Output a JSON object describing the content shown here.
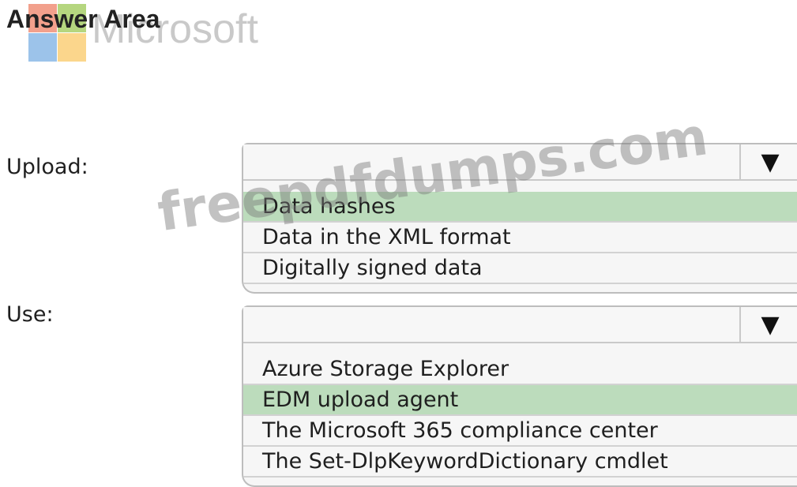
{
  "header": {
    "title": "Answer Area",
    "brand": "Microsoft"
  },
  "questions": [
    {
      "label": "Upload:",
      "options": [
        "Data hashes",
        "Data in the XML format",
        "Digitally signed data"
      ],
      "selected_index": 0
    },
    {
      "label": "Use:",
      "options": [
        "Azure Storage Explorer",
        "EDM upload agent",
        "The Microsoft 365 compliance center",
        "The Set-DlpKeywordDictionary cmdlet"
      ],
      "selected_index": 1
    }
  ],
  "dropdown_arrow": "▼",
  "watermark": "freepdfdumps.com",
  "colors": {
    "selected_option": "#bcdcbc",
    "logo_red": "#f2a08c",
    "logo_green": "#b5d67f",
    "logo_blue": "#9cc3ea",
    "logo_yellow": "#fbd68c"
  }
}
